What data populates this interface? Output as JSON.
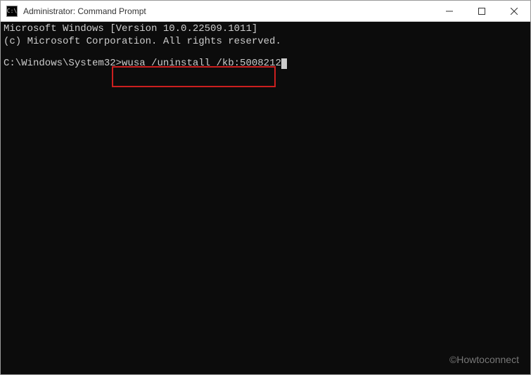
{
  "titlebar": {
    "icon_text": "C:\\",
    "title": "Administrator: Command Prompt"
  },
  "terminal": {
    "line1": "Microsoft Windows [Version 10.0.22509.1011]",
    "line2": "(c) Microsoft Corporation. All rights reserved.",
    "prompt": "C:\\Windows\\System32>",
    "command": "wusa /uninstall /kb:5008212"
  },
  "watermark": "©Howtoconnect"
}
